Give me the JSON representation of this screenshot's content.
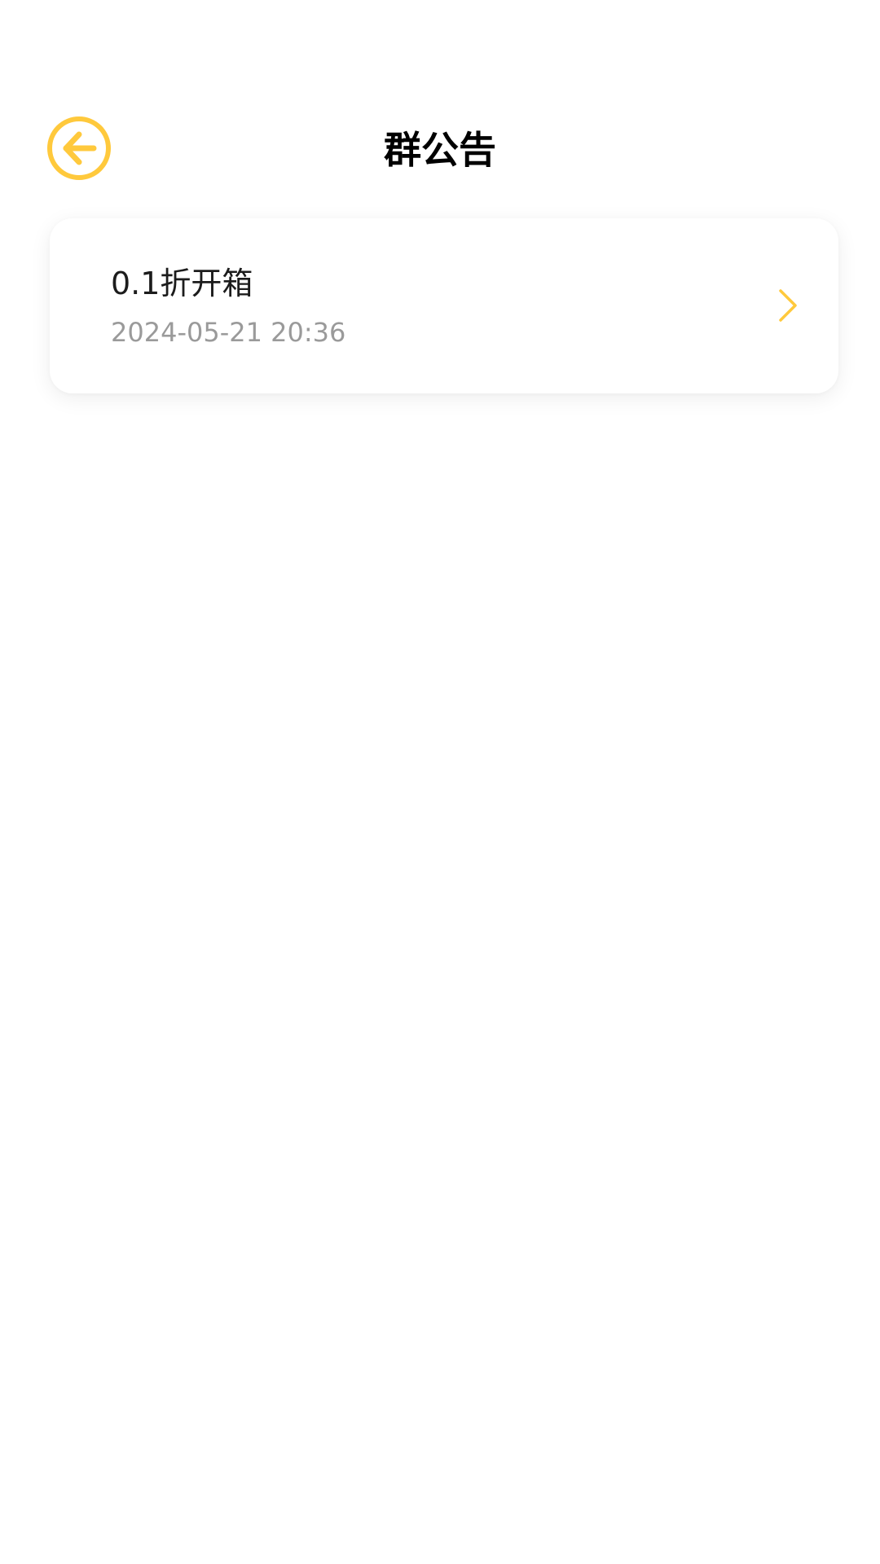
{
  "header": {
    "title": "群公告",
    "back_icon": "arrow-left-circle-icon",
    "accent_color": "#FFC93C"
  },
  "notices": [
    {
      "title": "0.1折开箱",
      "time": "2024-05-21 20:36",
      "chevron_icon": "chevron-right-icon"
    }
  ],
  "colors": {
    "background": "#FFFFFF",
    "title_text": "#000000",
    "item_text": "#1C1C1C",
    "secondary_text": "#9A9A9A",
    "accent": "#FFC93C"
  }
}
